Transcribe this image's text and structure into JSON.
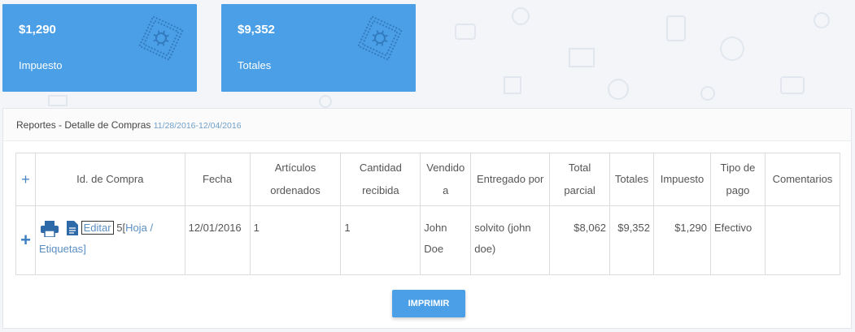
{
  "cards": [
    {
      "amount": "$1,290",
      "label": "Impuesto",
      "icon": "badge-icon"
    },
    {
      "amount": "$9,352",
      "label": "Totales",
      "icon": "badge-icon"
    }
  ],
  "panel": {
    "title": "Reportes - Detalle de Compras",
    "date_range": "11/28/2016-12/04/2016"
  },
  "table": {
    "headers": {
      "expand": "+",
      "id": "Id. de Compra",
      "date": "Fecha",
      "items_ordered": "Artículos ordenados",
      "qty_received": "Cantidad recibida",
      "sold_to": "Vendido a",
      "delivered_by": "Entregado por",
      "subtotal": "Total parcial",
      "totals": "Totales",
      "tax": "Impuesto",
      "payment_type": "Tipo de pago",
      "comments": "Comentarios"
    },
    "rows": [
      {
        "expand": "+",
        "edit": "Editar",
        "id_number": "5",
        "open_bracket": "[",
        "sheet_link": "Hoja",
        "slash": "/",
        "labels_link": "Etiquetas",
        "close_bracket": "]",
        "date": "12/01/2016",
        "items_ordered": "1",
        "qty_received": "1",
        "sold_to": "John Doe",
        "delivered_by": "solvito (john doe)",
        "subtotal": "$8,062",
        "totals": "$9,352",
        "tax": "$1,290",
        "payment_type": "Efectivo",
        "comments": ""
      }
    ]
  },
  "print_button": "IMPRIMIR",
  "colors": {
    "accent": "#4a9fe6",
    "link": "#5b8fc4"
  }
}
